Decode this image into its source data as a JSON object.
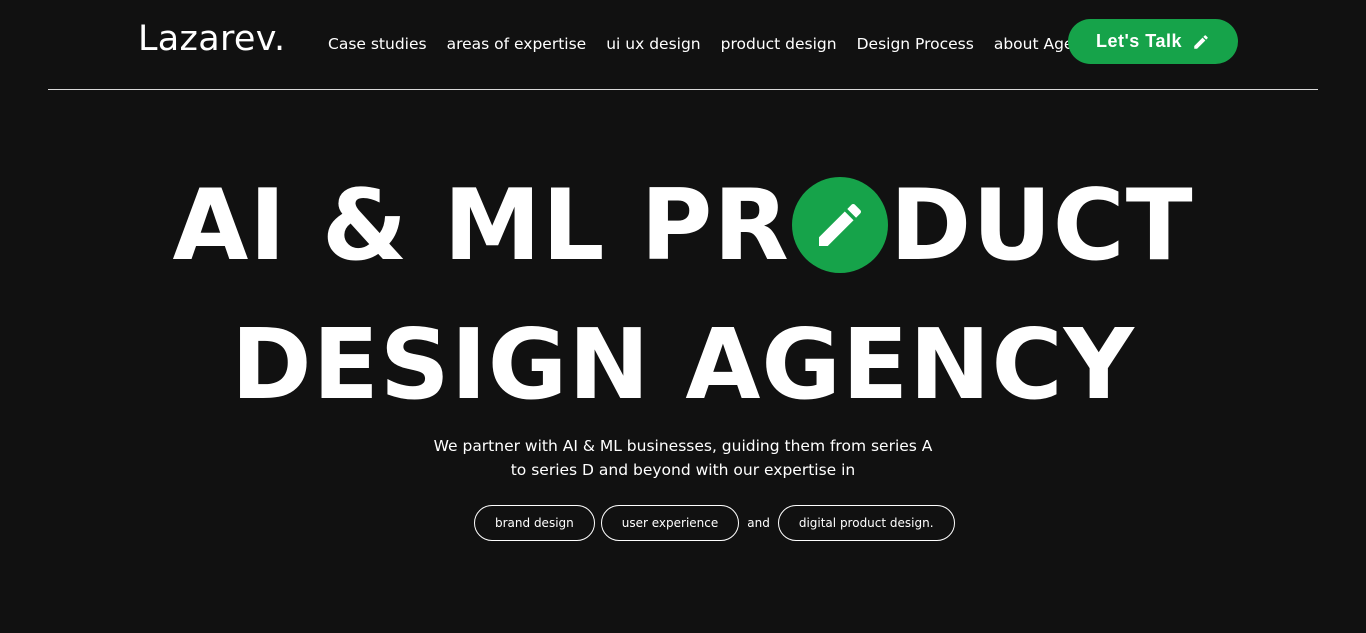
{
  "header": {
    "logo": "Lazarev.",
    "nav": [
      {
        "label": "Case studies"
      },
      {
        "label": "areas of expertise"
      },
      {
        "label": "ui ux design"
      },
      {
        "label": "product design"
      },
      {
        "label": "Design Process"
      },
      {
        "label": "about Agency"
      }
    ],
    "cta_label": "Let's Talk",
    "cta_icon": "pencil-icon"
  },
  "hero": {
    "line1_before": "AI & ML PR",
    "line1_after": "DUCT",
    "line2": "DESIGN AGENCY",
    "o_icon": "pencil-icon",
    "subtitle_line1": "We partner with AI & ML businesses, guiding them from series A",
    "subtitle_line2": "to series D and beyond with our expertise in",
    "tags": [
      {
        "label": "brand design"
      },
      {
        "label": "user experience"
      },
      {
        "label": "digital product design."
      }
    ],
    "and_text": "and"
  },
  "colors": {
    "background": "#111111",
    "accent": "#16a34a",
    "text": "#ffffff"
  }
}
